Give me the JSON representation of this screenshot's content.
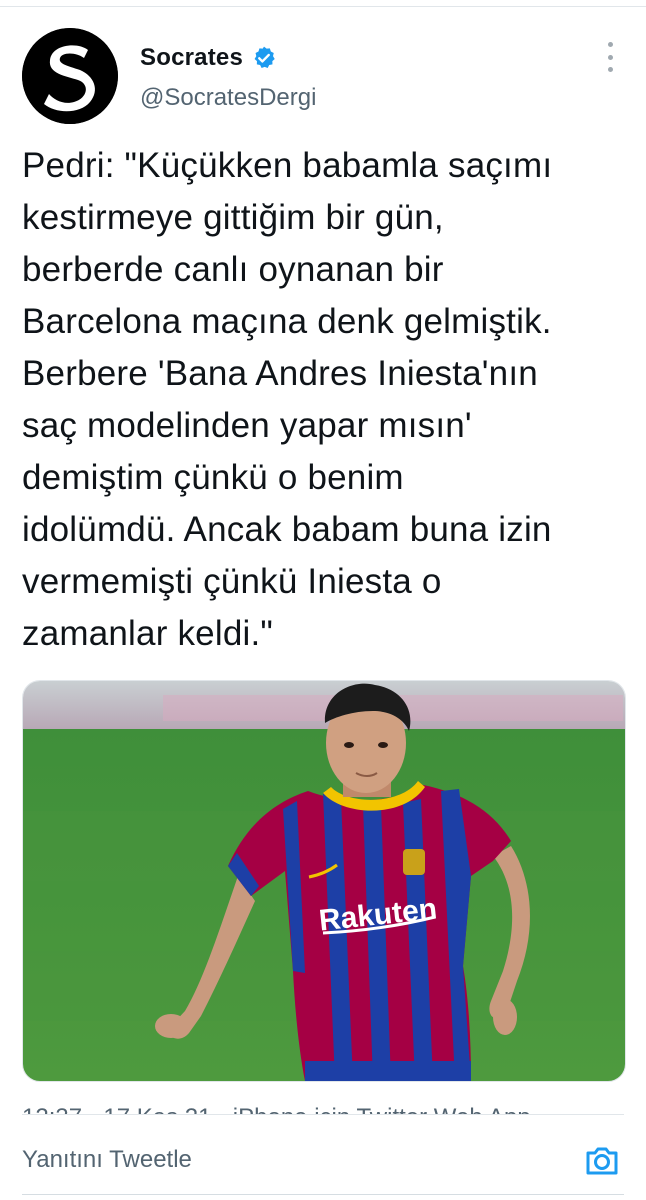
{
  "accent_color": "#1d9bf0",
  "author": {
    "display_name": "Socrates",
    "handle": "@SocratesDergi",
    "verified": true,
    "avatar_letter": "S"
  },
  "tweet": {
    "text": "Pedri: \"Küçükken babamla saçımı\nkestirmeye gittiğim bir gün,\nberberde canlı oynanan bir\nBarcelona maçına denk gelmiştik.\nBerbere 'Bana Andres Iniesta'nın\nsaç modelinden yapar mısın'\ndemiştim çünkü o benim\nidolümdü. Ancak babam buna izin\nvermemişti çünkü Iniesta o\nzamanlar keldi.\"",
    "timestamp_partial": "12:37 · 17 Kas 21 · iPhone için Twitter Web App",
    "image_jersey_sponsor": "Rakuten"
  },
  "reply": {
    "placeholder": "Yanıtını Tweetle"
  },
  "icons": {
    "verified": "verified-badge-icon",
    "more": "more-options-icon",
    "camera": "camera-icon"
  }
}
